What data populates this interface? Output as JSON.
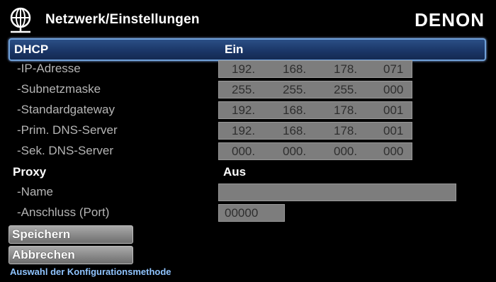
{
  "header": {
    "title": "Netzwerk/Einstellungen",
    "brand": "DENON",
    "icon": "globe-network-icon"
  },
  "dhcp": {
    "label": "DHCP",
    "value": "Ein"
  },
  "ip_address": {
    "label": "-IP-Adresse",
    "octets": [
      "192.",
      "168.",
      "178.",
      "071"
    ]
  },
  "subnet_mask": {
    "label": "-Subnetzmaske",
    "octets": [
      "255.",
      "255.",
      "255.",
      "000"
    ]
  },
  "gateway": {
    "label": "-Standardgateway",
    "octets": [
      "192.",
      "168.",
      "178.",
      "001"
    ]
  },
  "dns_primary": {
    "label": "-Prim. DNS-Server",
    "octets": [
      "192.",
      "168.",
      "178.",
      "001"
    ]
  },
  "dns_secondary": {
    "label": "-Sek. DNS-Server",
    "octets": [
      "000.",
      "000.",
      "000.",
      "000"
    ]
  },
  "proxy": {
    "label": "Proxy",
    "value": "Aus",
    "name_label": "-Name",
    "name_value": "",
    "port_label": "-Anschluss (Port)",
    "port_value": "00000"
  },
  "buttons": {
    "save": "Speichern",
    "cancel": "Abbrechen"
  },
  "status": "Auswahl der Konfigurationsmethode",
  "colors": {
    "highlight": "#1a3565",
    "highlight_border": "#6fa0d8",
    "field": "#7d7d7d",
    "status_text": "#8fc4ff"
  }
}
